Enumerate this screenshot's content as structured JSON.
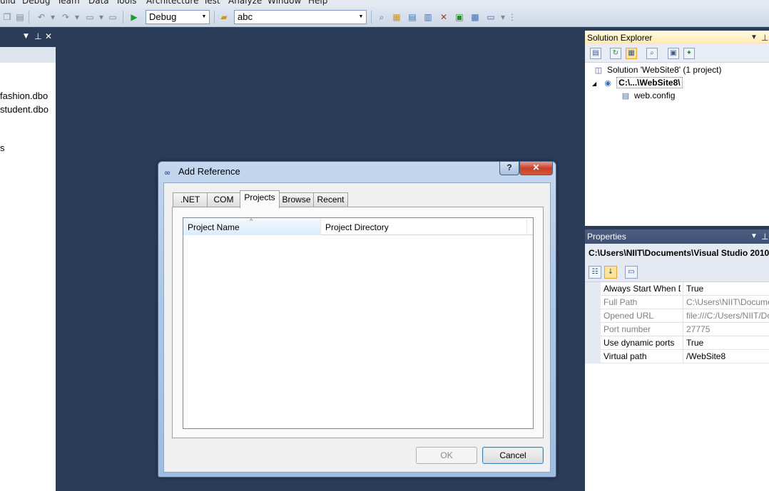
{
  "menu": [
    "uild",
    "Debug",
    "Team",
    "Data",
    "Tools",
    "Architecture",
    "Test",
    "Analyze",
    "Window",
    "Help"
  ],
  "toolbar": {
    "config_value": "Debug",
    "target_value": "abc"
  },
  "left_panel": {
    "items": [
      "fashion.dbo",
      "student.dbo",
      "s"
    ]
  },
  "solution_explorer": {
    "title": "Solution Explorer",
    "tree": {
      "solution": "Solution 'WebSite8' (1 project)",
      "project": "C:\\...\\WebSite8\\",
      "file": "web.config"
    }
  },
  "properties": {
    "title": "Properties",
    "object_path": "C:\\Users\\NIIT\\Documents\\Visual Studio 2010\\",
    "rows": [
      {
        "name": "Always Start When D",
        "value": "True"
      },
      {
        "name": "Full Path",
        "value": "C:\\Users\\NIIT\\Docume"
      },
      {
        "name": "Opened URL",
        "value": "file:///C:/Users/NIIT/Do"
      },
      {
        "name": "Port number",
        "value": "27775"
      },
      {
        "name": "Use dynamic ports",
        "value": "True"
      },
      {
        "name": "Virtual path",
        "value": "/WebSite8"
      }
    ]
  },
  "dialog": {
    "title": "Add Reference",
    "help_label": "?",
    "close_label": "✕",
    "tabs": [
      ".NET",
      "COM",
      "Projects",
      "Browse",
      "Recent"
    ],
    "active_tab": "Projects",
    "columns": [
      "Project Name",
      "Project Directory"
    ],
    "ok_label": "OK",
    "cancel_label": "Cancel"
  },
  "colors": {
    "ide_background": "#2b3c59",
    "panel_header": "#ffe9a8",
    "close_button": "#c6402a"
  }
}
